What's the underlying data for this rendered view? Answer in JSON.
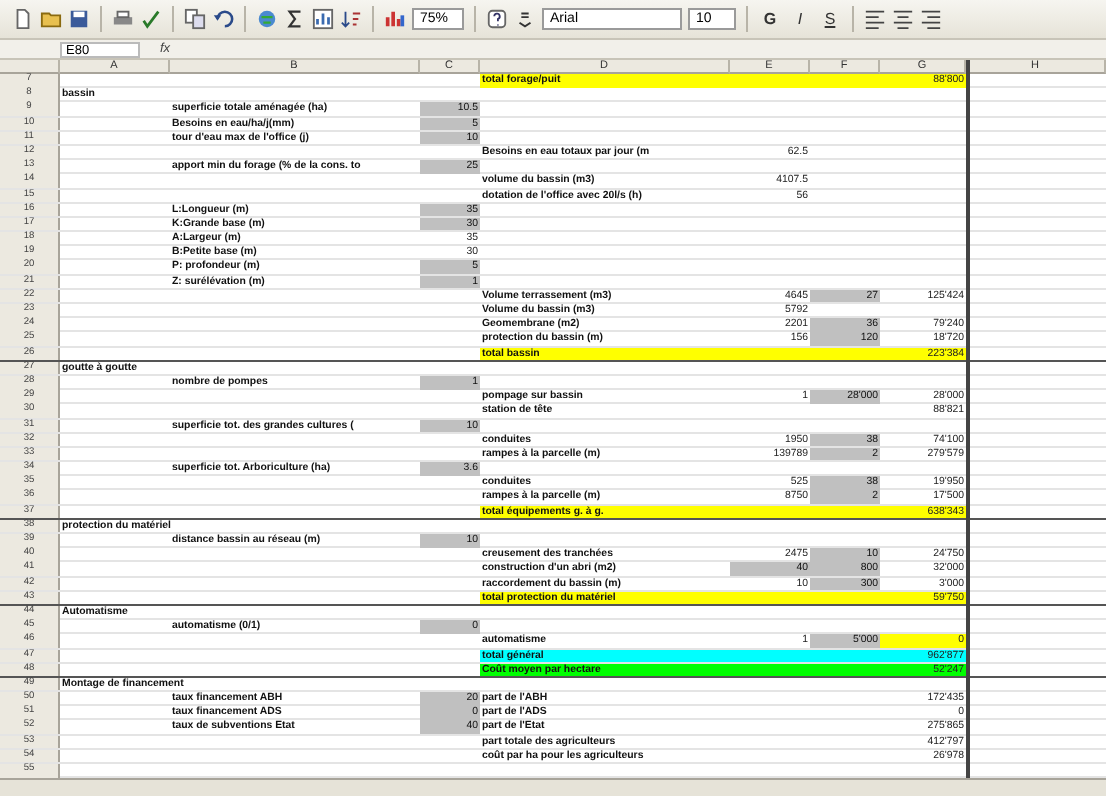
{
  "toolbar": {
    "zoom": "75%",
    "font": "Arial",
    "size": "10",
    "format_buttons": [
      "G",
      "I",
      "S"
    ]
  },
  "formula_bar": {
    "name_box": "E80",
    "fx": "fx"
  },
  "columns": [
    "A",
    "B",
    "C",
    "D",
    "E",
    "F",
    "G",
    "H"
  ],
  "rows": [
    {
      "num": "7",
      "color": "#ffff00",
      "rule": false,
      "d": {
        "text": "total forage/puit",
        "kind": "label"
      },
      "g": {
        "text": "88'800",
        "kind": "number"
      }
    },
    {
      "num": "8",
      "rule": false,
      "a": {
        "text": "bassin",
        "kind": "label"
      }
    },
    {
      "num": "9",
      "rule": false,
      "b": {
        "text": "superficie totale aménagée (ha)",
        "kind": "label"
      },
      "c": {
        "text": "10.5",
        "kind": "input"
      }
    },
    {
      "num": "10",
      "rule": false,
      "b": {
        "text": "Besoins en eau/ha/j(mm)",
        "kind": "label"
      },
      "c": {
        "text": "5",
        "kind": "input"
      }
    },
    {
      "num": "11",
      "rule": false,
      "b": {
        "text": "tour d'eau max de l'office (j)",
        "kind": "label"
      },
      "c": {
        "text": "10",
        "kind": "input"
      }
    },
    {
      "num": "12",
      "rule": false,
      "d": {
        "text": "Besoins en eau totaux par jour (m",
        "kind": "label"
      },
      "e": {
        "text": "62.5",
        "kind": "number"
      }
    },
    {
      "num": "13",
      "rule": false,
      "b": {
        "text": "apport min du forage (% de la cons. to",
        "kind": "label"
      },
      "c": {
        "text": "25",
        "kind": "input"
      }
    },
    {
      "num": "14",
      "rule": false,
      "d": {
        "text": "volume du bassin (m3)",
        "kind": "label"
      },
      "e": {
        "text": "4107.5",
        "kind": "number"
      }
    },
    {
      "num": "15",
      "rule": false,
      "d": {
        "text": "dotation de l'office avec 20l/s (h)",
        "kind": "label"
      },
      "e": {
        "text": "56",
        "kind": "number"
      }
    },
    {
      "num": "16",
      "rule": false,
      "b": {
        "text": "L:Longueur (m)",
        "kind": "label"
      },
      "c": {
        "text": "35",
        "kind": "input"
      }
    },
    {
      "num": "17",
      "rule": false,
      "b": {
        "text": "K:Grande base (m)",
        "kind": "label"
      },
      "c": {
        "text": "30",
        "kind": "input"
      }
    },
    {
      "num": "18",
      "rule": false,
      "b": {
        "text": "A:Largeur (m)",
        "kind": "label"
      },
      "c": {
        "text": "35",
        "kind": "number"
      }
    },
    {
      "num": "19",
      "rule": false,
      "b": {
        "text": "B:Petite base (m)",
        "kind": "label"
      },
      "c": {
        "text": "30",
        "kind": "number"
      }
    },
    {
      "num": "20",
      "rule": false,
      "b": {
        "text": "P: profondeur (m)",
        "kind": "label"
      },
      "c": {
        "text": "5",
        "kind": "input"
      }
    },
    {
      "num": "21",
      "rule": false,
      "b": {
        "text": "Z: surélévation (m)",
        "kind": "label"
      },
      "c": {
        "text": "1",
        "kind": "input"
      }
    },
    {
      "num": "22",
      "rule": false,
      "d": {
        "text": "Volume terrassement (m3)",
        "kind": "label"
      },
      "e": {
        "text": "4645",
        "kind": "number"
      },
      "f": {
        "text": "27",
        "kind": "input"
      },
      "g": {
        "text": "125'424",
        "kind": "number"
      }
    },
    {
      "num": "23",
      "rule": false,
      "d": {
        "text": "Volume du bassin (m3)",
        "kind": "label"
      },
      "e": {
        "text": "5792",
        "kind": "number"
      }
    },
    {
      "num": "24",
      "rule": false,
      "d": {
        "text": "Geomembrane (m2)",
        "kind": "label"
      },
      "e": {
        "text": "2201",
        "kind": "number"
      },
      "f": {
        "text": "36",
        "kind": "input"
      },
      "g": {
        "text": "79'240",
        "kind": "number"
      }
    },
    {
      "num": "25",
      "rule": false,
      "d": {
        "text": "protection du bassin (m)",
        "kind": "label"
      },
      "e": {
        "text": "156",
        "kind": "number"
      },
      "f": {
        "text": "120",
        "kind": "input"
      },
      "g": {
        "text": "18'720",
        "kind": "number"
      }
    },
    {
      "num": "26",
      "color": "#ffff00",
      "rule": true,
      "d": {
        "text": "total bassin",
        "kind": "label"
      },
      "g": {
        "text": "223'384",
        "kind": "number"
      }
    },
    {
      "num": "27",
      "rule": false,
      "a": {
        "text": "goutte à goutte",
        "kind": "label"
      }
    },
    {
      "num": "28",
      "rule": false,
      "b": {
        "text": "nombre de pompes",
        "kind": "label"
      },
      "c": {
        "text": "1",
        "kind": "input"
      }
    },
    {
      "num": "29",
      "rule": false,
      "d": {
        "text": "pompage sur bassin",
        "kind": "label"
      },
      "e": {
        "text": "1",
        "kind": "number"
      },
      "f": {
        "text": "28'000",
        "kind": "input"
      },
      "g": {
        "text": "28'000",
        "kind": "number"
      }
    },
    {
      "num": "30",
      "rule": false,
      "d": {
        "text": "station de tête",
        "kind": "label"
      },
      "g": {
        "text": "88'821",
        "kind": "number"
      }
    },
    {
      "num": "31",
      "rule": false,
      "b": {
        "text": "superficie tot. des grandes cultures (",
        "kind": "label"
      },
      "c": {
        "text": "10",
        "kind": "input"
      }
    },
    {
      "num": "32",
      "rule": false,
      "d": {
        "text": "conduites",
        "kind": "label"
      },
      "e": {
        "text": "1950",
        "kind": "number"
      },
      "f": {
        "text": "38",
        "kind": "input"
      },
      "g": {
        "text": "74'100",
        "kind": "number"
      }
    },
    {
      "num": "33",
      "rule": false,
      "d": {
        "text": "rampes à la parcelle (m)",
        "kind": "label"
      },
      "e": {
        "text": "139789",
        "kind": "number"
      },
      "f": {
        "text": "2",
        "kind": "input"
      },
      "g": {
        "text": "279'579",
        "kind": "number"
      }
    },
    {
      "num": "34",
      "rule": false,
      "b": {
        "text": "superficie tot. Arboriculture (ha)",
        "kind": "label"
      },
      "c": {
        "text": "3.6",
        "kind": "input"
      }
    },
    {
      "num": "35",
      "rule": false,
      "d": {
        "text": "conduites",
        "kind": "label"
      },
      "e": {
        "text": "525",
        "kind": "number"
      },
      "f": {
        "text": "38",
        "kind": "input"
      },
      "g": {
        "text": "19'950",
        "kind": "number"
      }
    },
    {
      "num": "36",
      "rule": false,
      "d": {
        "text": "rampes à la parcelle (m)",
        "kind": "label"
      },
      "e": {
        "text": "8750",
        "kind": "number"
      },
      "f": {
        "text": "2",
        "kind": "input"
      },
      "g": {
        "text": "17'500",
        "kind": "number"
      }
    },
    {
      "num": "37",
      "color": "#ffff00",
      "rule": true,
      "d": {
        "text": "total équipements g. à g.",
        "kind": "label"
      },
      "g": {
        "text": "638'343",
        "kind": "number"
      }
    },
    {
      "num": "38",
      "rule": false,
      "a": {
        "text": "protection du matériel",
        "kind": "label"
      }
    },
    {
      "num": "39",
      "rule": false,
      "b": {
        "text": "distance bassin au réseau (m)",
        "kind": "label"
      },
      "c": {
        "text": "10",
        "kind": "input"
      }
    },
    {
      "num": "40",
      "rule": false,
      "d": {
        "text": "creusement des tranchées",
        "kind": "label"
      },
      "e": {
        "text": "2475",
        "kind": "number"
      },
      "f": {
        "text": "10",
        "kind": "input"
      },
      "g": {
        "text": "24'750",
        "kind": "number"
      }
    },
    {
      "num": "41",
      "rule": false,
      "d": {
        "text": "construction d'un abri (m2)",
        "kind": "label"
      },
      "e": {
        "text": "40",
        "kind": "input"
      },
      "f": {
        "text": "800",
        "kind": "input"
      },
      "g": {
        "text": "32'000",
        "kind": "number"
      }
    },
    {
      "num": "42",
      "rule": false,
      "d": {
        "text": "raccordement du bassin (m)",
        "kind": "label"
      },
      "e": {
        "text": "10",
        "kind": "number"
      },
      "f": {
        "text": "300",
        "kind": "input"
      },
      "g": {
        "text": "3'000",
        "kind": "number"
      }
    },
    {
      "num": "43",
      "color": "#ffff00",
      "rule": true,
      "d": {
        "text": "total protection du matériel",
        "kind": "label"
      },
      "g": {
        "text": "59'750",
        "kind": "number"
      }
    },
    {
      "num": "44",
      "rule": false,
      "a": {
        "text": "Automatisme",
        "kind": "label"
      }
    },
    {
      "num": "45",
      "rule": false,
      "b": {
        "text": "automatisme (0/1)",
        "kind": "label"
      },
      "c": {
        "text": "0",
        "kind": "input"
      }
    },
    {
      "num": "46",
      "rule": false,
      "d": {
        "text": "automatisme",
        "kind": "label"
      },
      "e": {
        "text": "1",
        "kind": "number"
      },
      "f": {
        "text": "5'000",
        "kind": "input"
      },
      "g": {
        "text": "0",
        "kind": "number",
        "color": "#ffff00"
      }
    },
    {
      "num": "47",
      "color": "#00ffff",
      "rule": false,
      "d": {
        "text": "total général",
        "kind": "label"
      },
      "g": {
        "text": "962'877",
        "kind": "number"
      }
    },
    {
      "num": "48",
      "color": "#00ff00",
      "rule": true,
      "d": {
        "text": "Coût moyen par hectare",
        "kind": "label"
      },
      "g": {
        "text": "52'247",
        "kind": "number"
      }
    },
    {
      "num": "49",
      "rule": false,
      "a": {
        "text": "Montage de financement",
        "kind": "label"
      }
    },
    {
      "num": "50",
      "rule": false,
      "b": {
        "text": "taux financement ABH",
        "kind": "label"
      },
      "c": {
        "text": "20",
        "kind": "input"
      },
      "d": {
        "text": "part de l'ABH",
        "kind": "label"
      },
      "g": {
        "text": "172'435",
        "kind": "number"
      }
    },
    {
      "num": "51",
      "rule": false,
      "b": {
        "text": "taux financement ADS",
        "kind": "label"
      },
      "c": {
        "text": "0",
        "kind": "input"
      },
      "d": {
        "text": "part de l'ADS",
        "kind": "label"
      },
      "g": {
        "text": "0",
        "kind": "number"
      }
    },
    {
      "num": "52",
      "rule": false,
      "b": {
        "text": "taux de subventions Etat",
        "kind": "label"
      },
      "c": {
        "text": "40",
        "kind": "input"
      },
      "d": {
        "text": "part de l'Etat",
        "kind": "label"
      },
      "g": {
        "text": "275'865",
        "kind": "number"
      }
    },
    {
      "num": "53",
      "rule": false,
      "d": {
        "text": "part totale des agriculteurs",
        "kind": "label"
      },
      "g": {
        "text": "412'797",
        "kind": "number"
      }
    },
    {
      "num": "54",
      "rule": false,
      "d": {
        "text": "coût par ha pour les agriculteurs",
        "kind": "label"
      },
      "g": {
        "text": "26'978",
        "kind": "number"
      }
    },
    {
      "num": "55",
      "rule": false
    }
  ]
}
